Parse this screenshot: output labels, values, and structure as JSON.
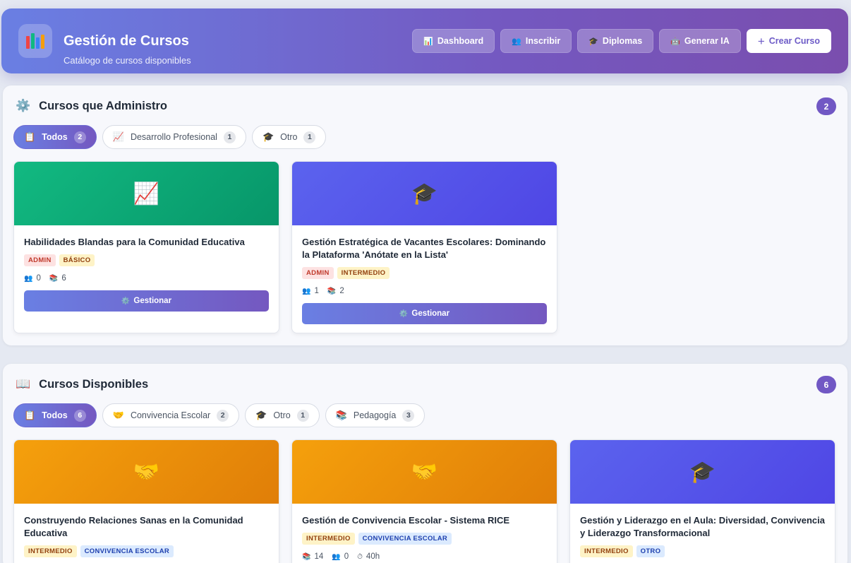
{
  "header": {
    "title": "Gestión de Cursos",
    "subtitle": "Catálogo de cursos disponibles",
    "buttons": [
      {
        "label": "Dashboard",
        "icon": "📊"
      },
      {
        "label": "Inscribir",
        "icon": "👥"
      },
      {
        "label": "Diplomas",
        "icon": "🎓"
      },
      {
        "label": "Generar IA",
        "icon": "🤖"
      }
    ],
    "create_button": {
      "label": "Crear Curso",
      "icon": "+"
    }
  },
  "admin_section": {
    "title": "Cursos que Administro",
    "icon": "⚙️",
    "count": "2",
    "filters": [
      {
        "label": "Todos",
        "icon": "📋",
        "count": "2"
      },
      {
        "label": "Desarrollo Profesional",
        "icon": "📈",
        "count": "1"
      },
      {
        "label": "Otro",
        "icon": "🎓",
        "count": "1"
      }
    ],
    "cards": [
      {
        "title": "Habilidades Blandas para la Comunidad Educativa",
        "icon": "📈",
        "tag_role": "ADMIN",
        "tag_level": "BÁSICO",
        "students": "0",
        "modules": "6",
        "button": "Gestionar",
        "button_icon": "⚙️",
        "color": "#10b981"
      },
      {
        "title": "Gestión Estratégica de Vacantes Escolares: Dominando la Plataforma 'Anótate en la Lista'",
        "icon": "🎓",
        "tag_role": "ADMIN",
        "tag_level": "INTERMEDIO",
        "students": "1",
        "modules": "2",
        "button": "Gestionar",
        "button_icon": "⚙️",
        "color": "#5b63ee"
      }
    ]
  },
  "available_section": {
    "title": "Cursos Disponibles",
    "icon": "📖",
    "count": "6",
    "filters": [
      {
        "label": "Todos",
        "icon": "📋",
        "count": "6"
      },
      {
        "label": "Convivencia Escolar",
        "icon": "🤝",
        "count": "2"
      },
      {
        "label": "Otro",
        "icon": "🎓",
        "count": "1"
      },
      {
        "label": "Pedagogía",
        "icon": "📚",
        "count": "3"
      }
    ],
    "cards": [
      {
        "title": "Construyendo Relaciones Sanas en la Comunidad Educativa",
        "icon": "🤝",
        "tag_level": "INTERMEDIO",
        "tag_category": "CONVIVENCIA ESCOLAR",
        "color": "#f59e0b"
      },
      {
        "title": "Gestión de Convivencia Escolar - Sistema RICE",
        "icon": "🤝",
        "tag_level": "INTERMEDIO",
        "tag_category": "CONVIVENCIA ESCOLAR",
        "modules": "14",
        "students": "0",
        "duration": "40h",
        "color": "#f59e0b"
      },
      {
        "title": "Gestión y Liderazgo en el Aula: Diversidad, Convivencia y Liderazgo Transformacional",
        "icon": "🎓",
        "tag_level": "INTERMEDIO",
        "tag_category": "OTRO",
        "color": "#5b63ee"
      }
    ]
  }
}
